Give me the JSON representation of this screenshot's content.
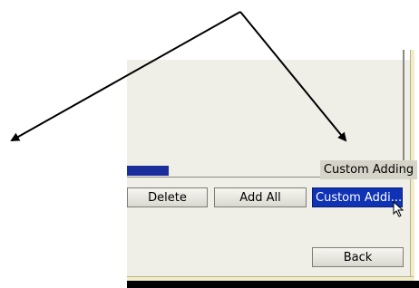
{
  "buttons": {
    "delete": "Delete",
    "add_all": "Add All",
    "custom_adding": "Custom Addi...",
    "back": "Back"
  },
  "tooltip": "Custom Adding",
  "colors": {
    "dialog_bg": "#efeee7",
    "selection": "#1032b5",
    "tooltip_bg": "#d6d4c9"
  },
  "icons": [
    "arrow-annotation-icon",
    "mouse-pointer-icon"
  ]
}
